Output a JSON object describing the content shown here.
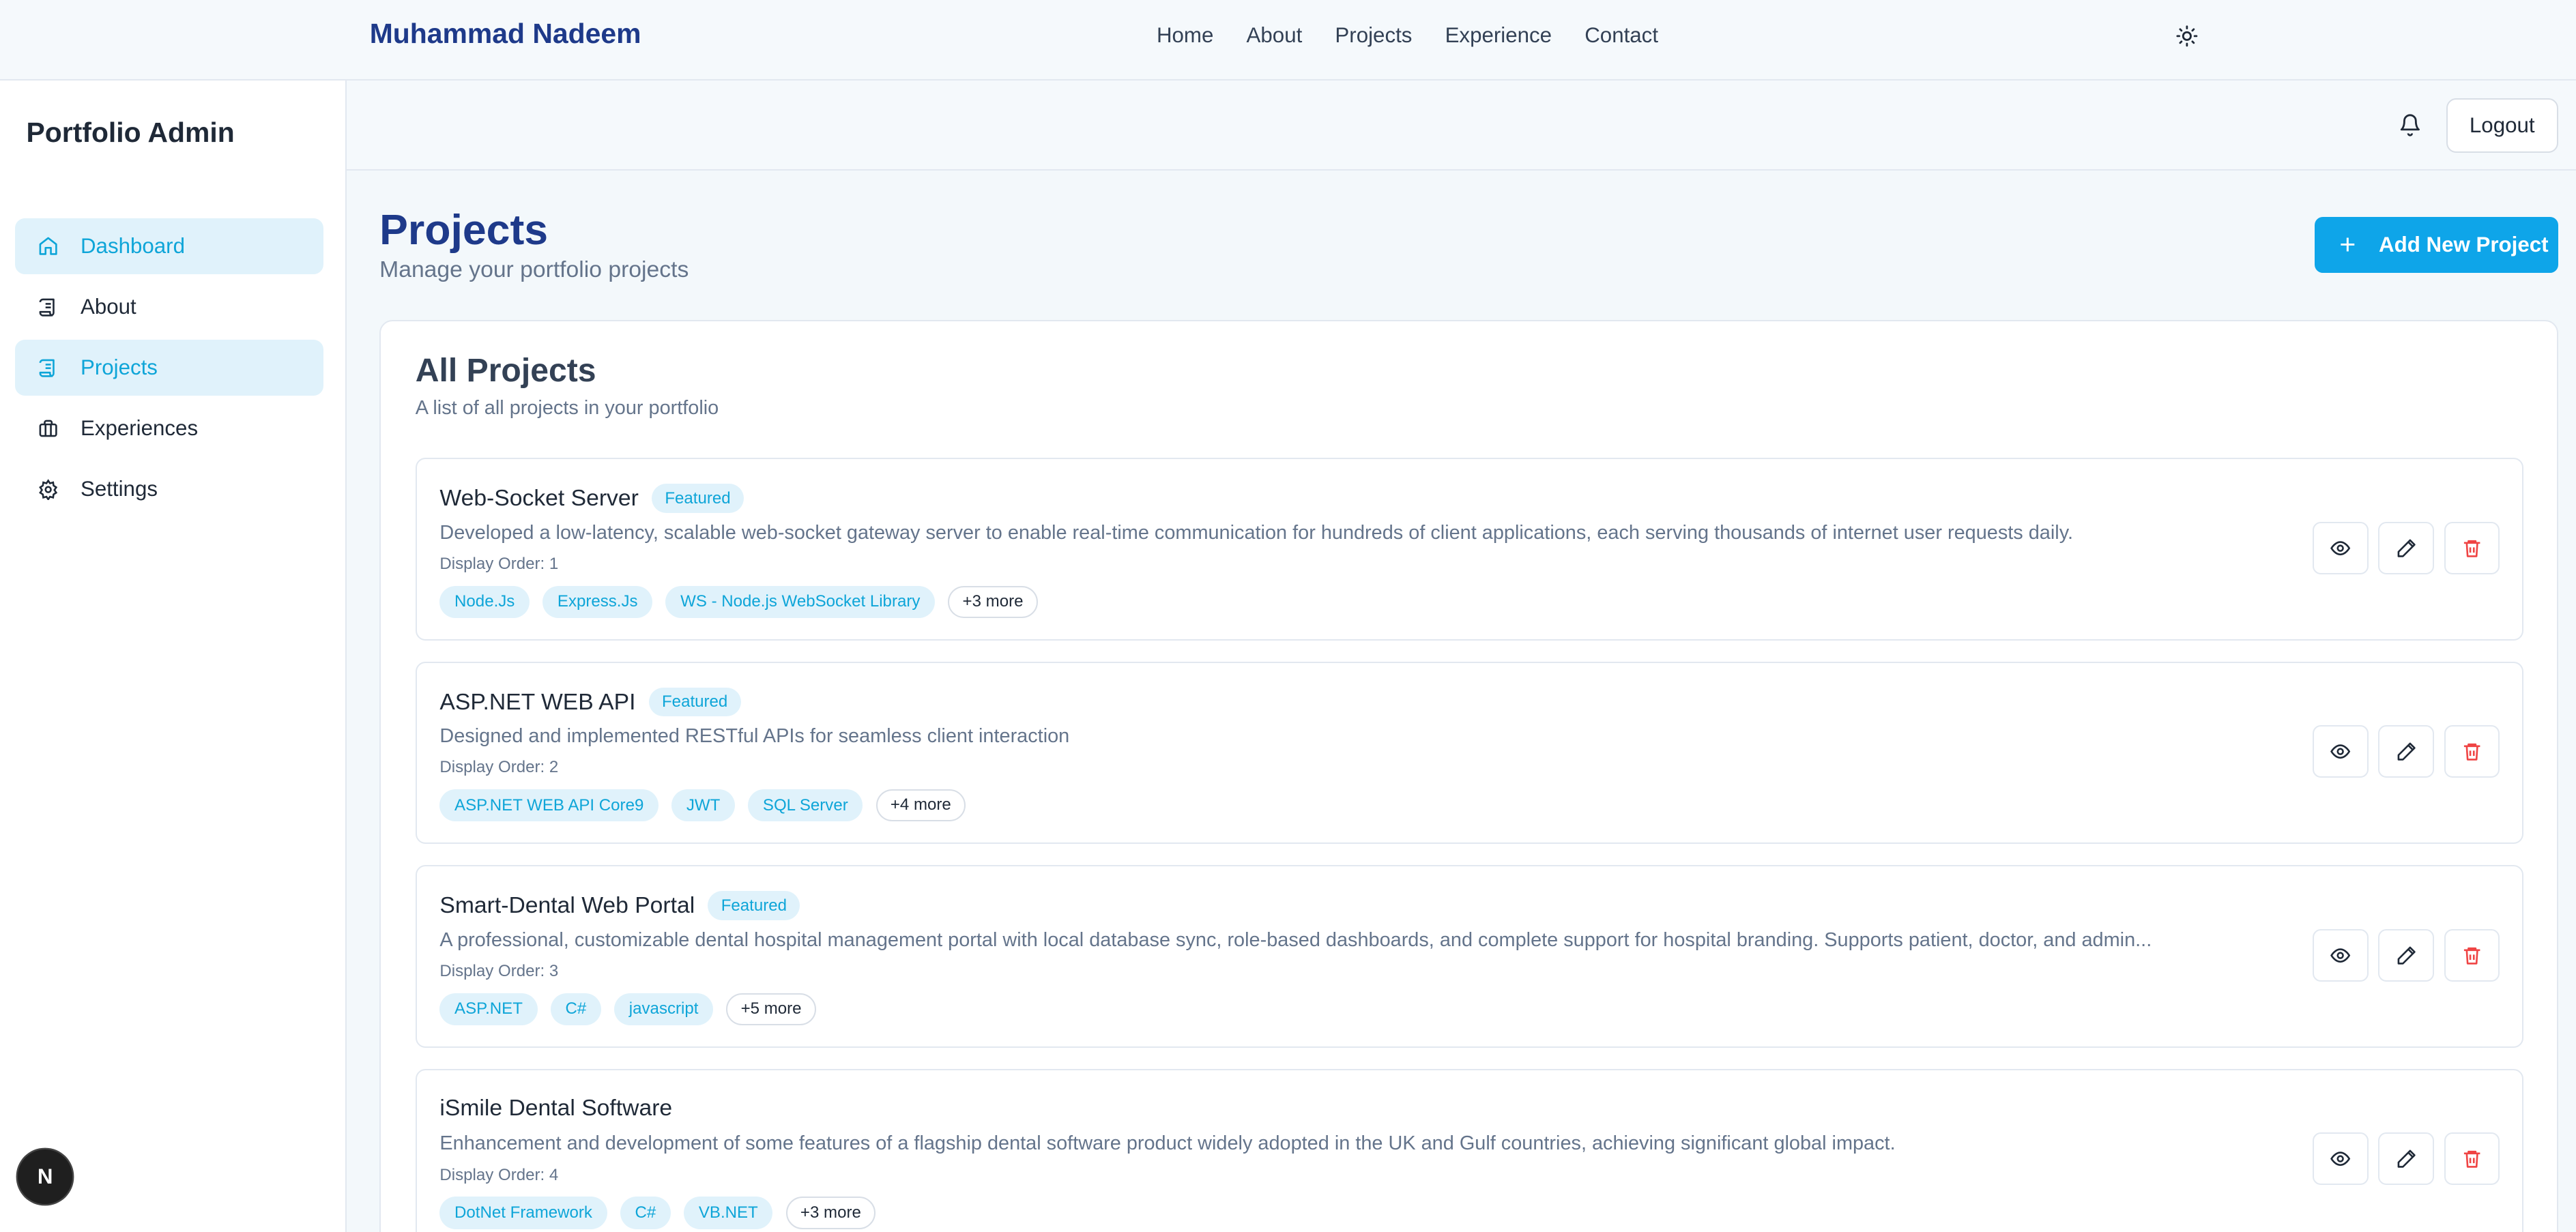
{
  "topnav": {
    "brand": "Muhammad Nadeem",
    "links": [
      "Home",
      "About",
      "Projects",
      "Experience",
      "Contact"
    ],
    "theme_icon": "sun-icon"
  },
  "sidebar": {
    "title": "Portfolio Admin",
    "items": [
      {
        "label": "Dashboard",
        "icon": "home-icon",
        "active": true
      },
      {
        "label": "About",
        "icon": "scroll-icon",
        "active": false
      },
      {
        "label": "Projects",
        "icon": "scroll-icon",
        "active": true
      },
      {
        "label": "Experiences",
        "icon": "briefcase-icon",
        "active": false
      },
      {
        "label": "Settings",
        "icon": "gear-icon",
        "active": false
      }
    ],
    "badge": "N"
  },
  "header": {
    "logout_label": "Logout",
    "bell_icon": "bell-icon"
  },
  "page": {
    "title": "Projects",
    "subtitle": "Manage your portfolio projects",
    "add_button": "Add New Project"
  },
  "card": {
    "title": "All Projects",
    "subtitle": "A list of all projects in your portfolio"
  },
  "projects": [
    {
      "name": "Web-Socket Server",
      "badge": "Featured",
      "description": "Developed a low-latency, scalable web-socket gateway server to enable real-time communication for hundreds of client applications, each serving thousands of internet user requests daily.",
      "order": "Display Order: 1",
      "tags": [
        "Node.Js",
        "Express.Js",
        "WS - Node.js WebSocket Library"
      ],
      "more": "+3 more"
    },
    {
      "name": "ASP.NET WEB API",
      "badge": "Featured",
      "description": "Designed and implemented RESTful APIs for seamless client interaction",
      "order": "Display Order: 2",
      "tags": [
        "ASP.NET WEB API Core9",
        "JWT",
        "SQL Server"
      ],
      "more": "+4 more"
    },
    {
      "name": "Smart-Dental Web Portal",
      "badge": "Featured",
      "description": "A professional, customizable dental hospital management portal with local database sync, role-based dashboards, and complete support for hospital branding. Supports patient, doctor, and admin...",
      "order": "Display Order: 3",
      "tags": [
        "ASP.NET",
        "C#",
        "javascript"
      ],
      "more": "+5 more"
    },
    {
      "name": "iSmile Dental Software",
      "badge": "",
      "description": "Enhancement and development of some features of a flagship dental software product widely adopted in the UK and Gulf countries, achieving significant global impact.",
      "order": "Display Order: 4",
      "tags": [
        "DotNet Framework",
        "C#",
        "VB.NET"
      ],
      "more": "+3 more"
    }
  ],
  "colors": {
    "accent": "#0ea5e9",
    "title_blue": "#1e3a8a",
    "delete_red": "#ef4444"
  }
}
